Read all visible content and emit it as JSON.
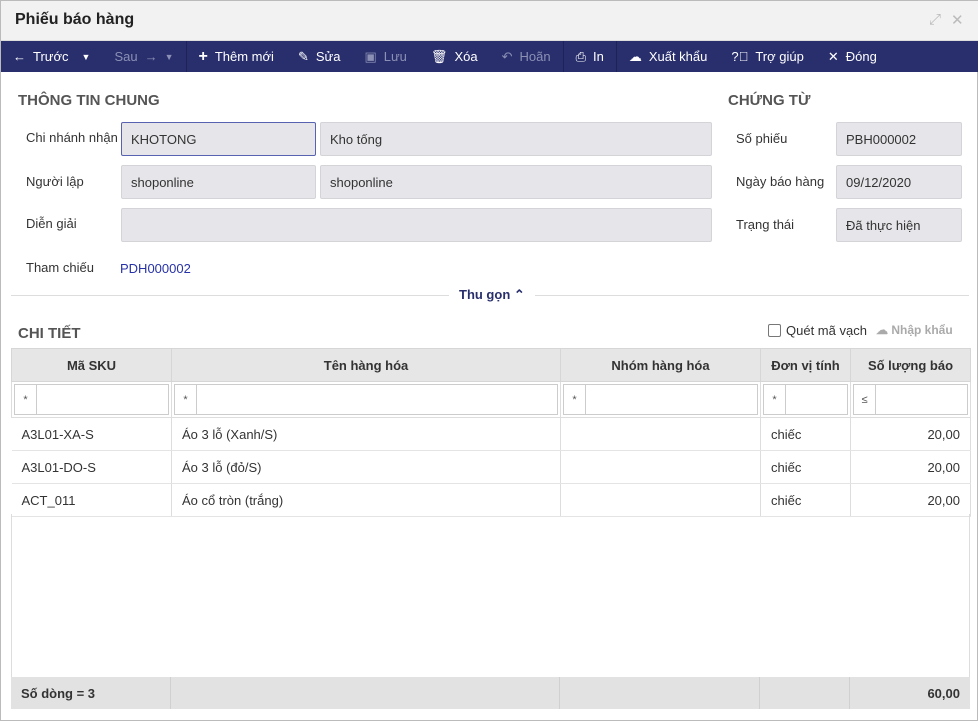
{
  "window": {
    "title": "Phiếu báo hàng"
  },
  "toolbar": {
    "prev": "Trước",
    "next": "Sau",
    "add": "Thêm mới",
    "edit": "Sửa",
    "save": "Lưu",
    "delete": "Xóa",
    "undo": "Hoãn",
    "print": "In",
    "export": "Xuất khẩu",
    "help": "Trợ giúp",
    "close": "Đóng"
  },
  "general": {
    "heading": "THÔNG TIN CHUNG",
    "branch_label": "Chi nhánh nhận",
    "branch_code": "KHOTONG",
    "branch_name": "Kho tống",
    "creator_label": "Người lập",
    "creator_code": "shoponline",
    "creator_name": "shoponline",
    "desc_label": "Diễn giải",
    "desc_value": "",
    "ref_label": "Tham chiếu",
    "ref_value": "PDH000002"
  },
  "voucher": {
    "heading": "CHỨNG TỪ",
    "no_label": "Số phiếu",
    "no_value": "PBH000002",
    "date_label": "Ngày báo hàng",
    "date_value": "09/12/2020",
    "status_label": "Trạng thái",
    "status_value": "Đã thực hiện"
  },
  "collapse_label": "Thu gọn",
  "detail": {
    "heading": "CHI TIẾT",
    "scan_label": "Quét mã vạch",
    "import_label": "Nhập khẩu",
    "columns": [
      "Mã SKU",
      "Tên hàng hóa",
      "Nhóm hàng hóa",
      "Đơn vị tính",
      "Số lượng báo"
    ],
    "filter_ops": [
      "*",
      "*",
      "*",
      "*",
      "≤"
    ],
    "rows": [
      {
        "sku": "A3L01-XA-S",
        "name": "Áo 3 lỗ (Xanh/S)",
        "group": "",
        "unit": "chiếc",
        "qty": "20,00"
      },
      {
        "sku": "A3L01-DO-S",
        "name": "Áo 3 lỗ (đỏ/S)",
        "group": "",
        "unit": "chiếc",
        "qty": "20,00"
      },
      {
        "sku": "ACT_011",
        "name": "Áo cổ tròn (trắng)",
        "group": "",
        "unit": "chiếc",
        "qty": "20,00"
      }
    ],
    "footer": {
      "count": "Số dòng = 3",
      "total": "60,00"
    }
  }
}
